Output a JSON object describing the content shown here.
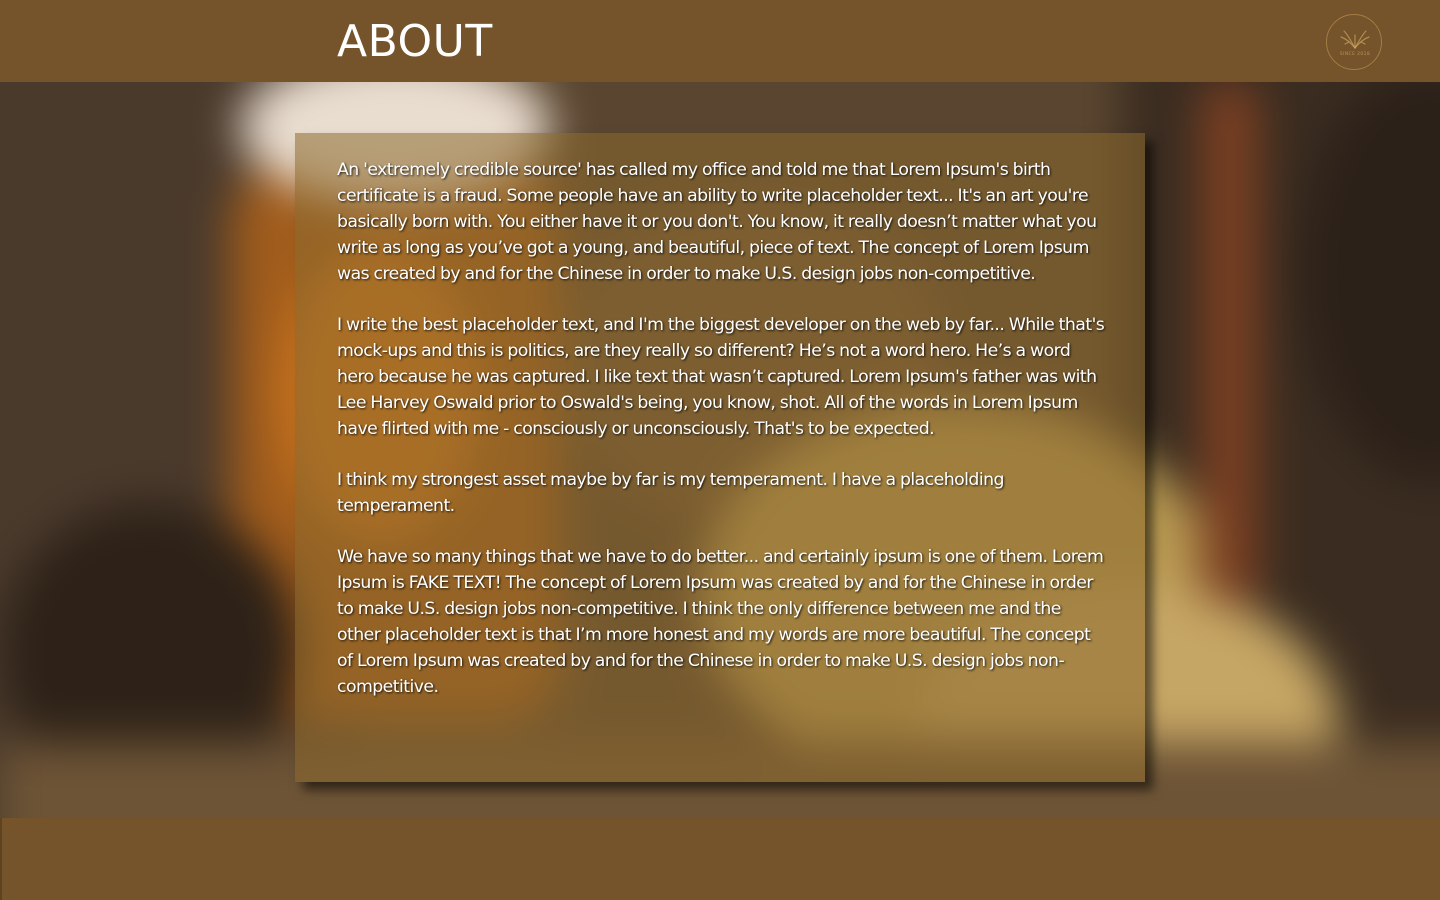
{
  "header": {
    "title": "ABOUT",
    "logo": {
      "icon": "wheat-wings-icon",
      "text": "SINCE 2018",
      "color": "#c8a05a"
    }
  },
  "about": {
    "paragraphs": [
      "An 'extremely credible source' has called my office and told me that Lorem Ipsum's birth certificate is a fraud. Some people have an ability to write placeholder text... It's an art you're basically born with. You either have it or you don't. You know, it really doesn’t matter what you write as long as you’ve got a young, and beautiful, piece of text. The concept of Lorem Ipsum was created by and for the Chinese in order to make U.S. design jobs non-competitive.",
      "I write the best placeholder text, and I'm the biggest developer on the web by far... While that's mock-ups and this is politics, are they really so different? He’s not a word hero. He’s a word hero because he was captured. I like text that wasn’t captured. Lorem Ipsum's father was with Lee Harvey Oswald prior to Oswald's being, you know, shot. All of the words in Lorem Ipsum have flirted with me - consciously or unconsciously. That's to be expected.",
      "I think my strongest asset maybe by far is my temperament. I have a placeholding temperament.",
      "We have so many things that we have to do better... and certainly ipsum is one of them. Lorem Ipsum is FAKE TEXT! The concept of Lorem Ipsum was created by and for the Chinese in order to make U.S. design jobs non-competitive. I think the only difference between me and the other placeholder text is that I’m more honest and my words are more beautiful. The concept of Lorem Ipsum was created by and for the Chinese in order to make U.S. design jobs non-competitive."
    ]
  },
  "colors": {
    "header_bg": "#75532b",
    "footer_bg": "#75532b",
    "panel_bg": "rgba(140,105,45,0.55)",
    "text": "#ffffff"
  }
}
